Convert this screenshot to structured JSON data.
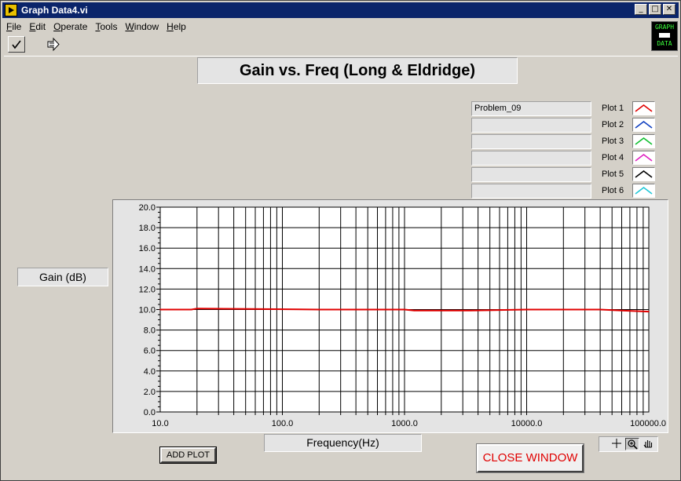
{
  "window": {
    "title": "Graph Data4.vi",
    "minimize": "_",
    "maximize": "□",
    "close": "✕"
  },
  "menu": {
    "items": [
      {
        "first": "F",
        "rest": "ile"
      },
      {
        "first": "E",
        "rest": "dit"
      },
      {
        "first": "O",
        "rest": "perate"
      },
      {
        "first": "T",
        "rest": "ools"
      },
      {
        "first": "W",
        "rest": "indow"
      },
      {
        "first": "H",
        "rest": "elp"
      }
    ]
  },
  "toolbar": {
    "run_icon": "checkmark-icon",
    "step_icon": "run-arrow-icon"
  },
  "logo": {
    "line1": "GRAPH",
    "line2": "DATA"
  },
  "graph": {
    "title": "Gain vs. Freq (Long & Eldridge)",
    "ylabel": "Gain (dB)",
    "xlabel": "Frequency(Hz)"
  },
  "legend": [
    {
      "name": "Problem_09",
      "label": "Plot 1",
      "color": "#e00000"
    },
    {
      "name": "",
      "label": "Plot 2",
      "color": "#1040c0"
    },
    {
      "name": "",
      "label": "Plot 3",
      "color": "#10c030"
    },
    {
      "name": "",
      "label": "Plot 4",
      "color": "#e020c0"
    },
    {
      "name": "",
      "label": "Plot 5",
      "color": "#000000"
    },
    {
      "name": "",
      "label": "Plot 6",
      "color": "#20c8d8"
    }
  ],
  "buttons": {
    "add_plot": "ADD PLOT",
    "close_window": "CLOSE WINDOW"
  },
  "palette": {
    "icons": [
      "crosshair-icon",
      "zoom-icon",
      "pan-hand-icon"
    ]
  },
  "chart_data": {
    "type": "line",
    "x_scale": "log",
    "xlim": [
      10,
      100000
    ],
    "ylim": [
      0,
      20
    ],
    "xticks": [
      "10.0",
      "100.0",
      "1000.0",
      "10000.0",
      "100000.0"
    ],
    "yticks": [
      "0.0",
      "2.0",
      "4.0",
      "6.0",
      "8.0",
      "10.0",
      "12.0",
      "14.0",
      "16.0",
      "18.0",
      "20.0"
    ],
    "grid": true,
    "series": [
      {
        "name": "Problem_09",
        "color": "#e00000",
        "x": [
          10,
          18,
          20,
          200,
          1000,
          1200,
          3500,
          10000,
          40000,
          60000,
          100000
        ],
        "y": [
          10.0,
          10.0,
          10.1,
          10.0,
          10.0,
          9.9,
          9.9,
          10.0,
          10.0,
          9.9,
          9.8
        ]
      }
    ]
  }
}
